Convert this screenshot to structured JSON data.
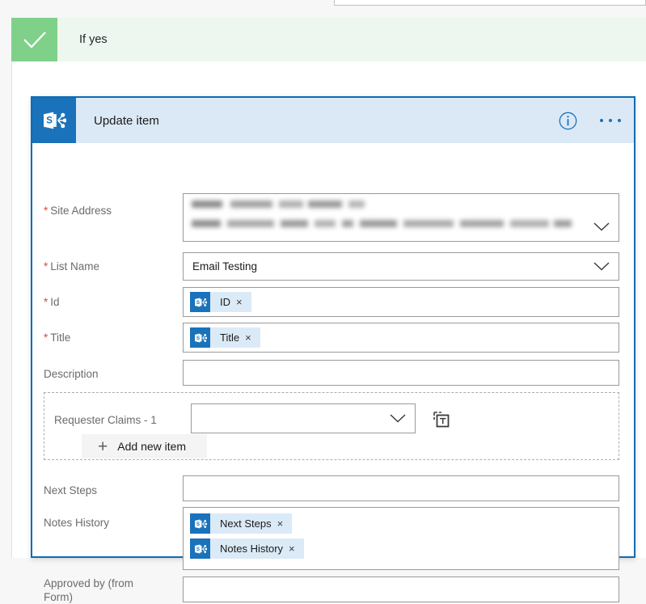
{
  "branch": {
    "label": "If yes",
    "check_icon": "checkmark-icon",
    "accent_color": "#7fd18a",
    "background_color": "#eef7ef"
  },
  "card": {
    "connector_icon": "sharepoint-icon",
    "title": "Update item",
    "info_icon": "info-circle-icon",
    "more_icon": "ellipsis-icon",
    "border_color": "#0b6cb5",
    "header_color": "#dbe9f6"
  },
  "fields": [
    {
      "label": "Site Address",
      "required": true,
      "type": "dropdown-redacted",
      "value": "",
      "redacted": true,
      "chevron": "chevron-down-icon"
    },
    {
      "label": "List Name",
      "required": true,
      "type": "dropdown",
      "value": "Email Testing",
      "chevron": "chevron-down-icon"
    },
    {
      "label": "Id",
      "required": true,
      "type": "tokens",
      "tokens": [
        {
          "label": "ID",
          "icon": "sharepoint-icon",
          "remove": "×"
        }
      ]
    },
    {
      "label": "Title",
      "required": true,
      "type": "tokens",
      "tokens": [
        {
          "label": "Title",
          "icon": "sharepoint-icon",
          "remove": "×"
        }
      ]
    },
    {
      "label": "Description",
      "required": false,
      "type": "text",
      "value": ""
    }
  ],
  "repeater": {
    "label": "Requester Claims - 1",
    "value": "",
    "chevron": "chevron-down-icon",
    "text_mode_icon": "switch-to-text-mode-icon",
    "add_button": {
      "plus": "+",
      "label": "Add new item"
    }
  },
  "fields_after": [
    {
      "label": "Next Steps",
      "required": false,
      "type": "text",
      "value": ""
    },
    {
      "label": "Notes History",
      "required": false,
      "type": "tokens",
      "tokens": [
        {
          "label": "Next Steps",
          "icon": "sharepoint-icon",
          "remove": "×"
        },
        {
          "label": "Notes History",
          "icon": "sharepoint-icon",
          "remove": "×"
        }
      ]
    },
    {
      "label": "Approved by (from Form)",
      "required": false,
      "type": "text",
      "value": ""
    }
  ],
  "required_marker": "*"
}
